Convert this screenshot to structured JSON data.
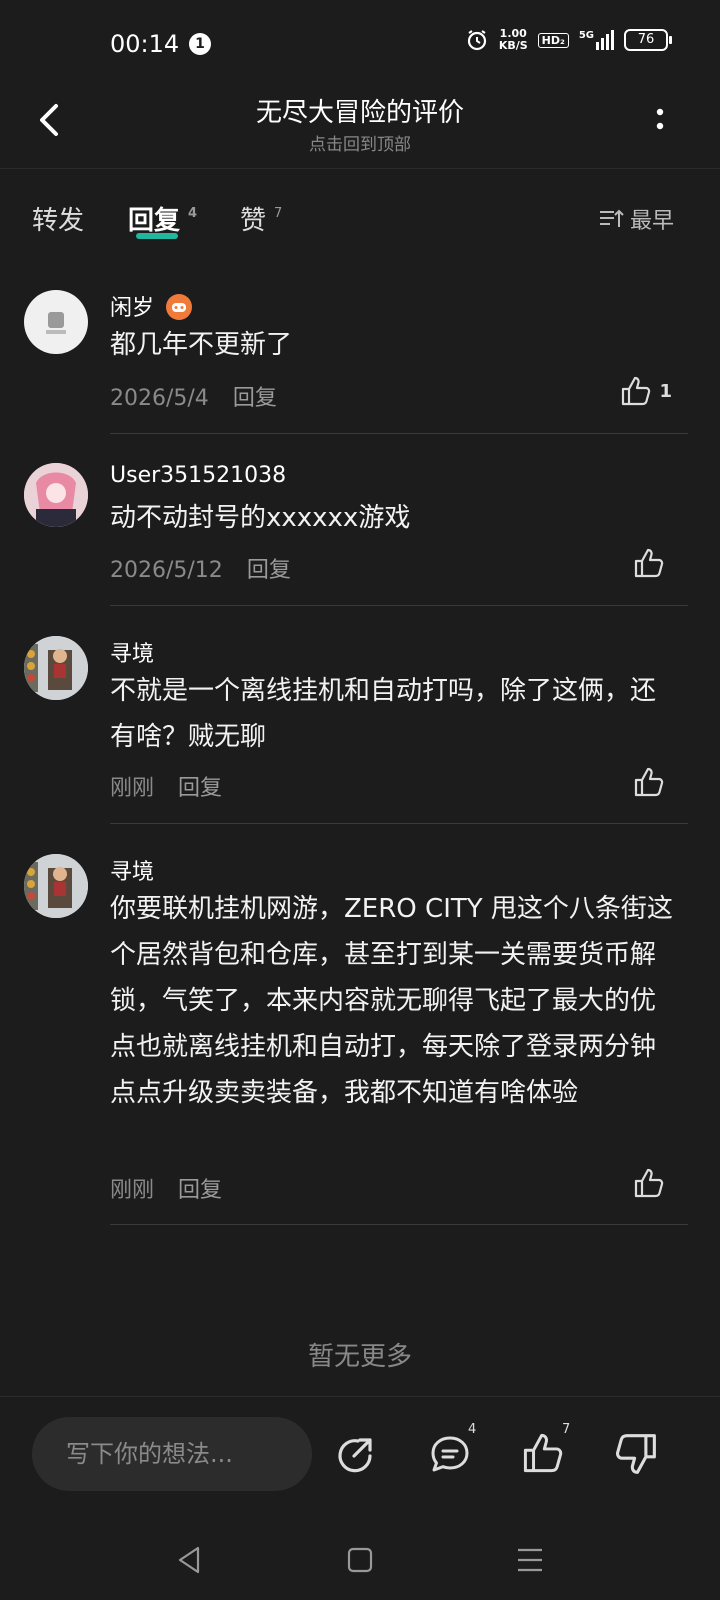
{
  "status": {
    "time": "00:14",
    "notif_count": "1",
    "speed_value": "1.00",
    "speed_unit": "KB/S",
    "hd": "HD₂",
    "network": "5G",
    "battery": "76"
  },
  "header": {
    "title": "无尽大冒险的评价",
    "subtitle": "点击回到顶部"
  },
  "tabs": [
    {
      "label": "转发",
      "count": ""
    },
    {
      "label": "回复",
      "count": "4"
    },
    {
      "label": "赞",
      "count": "7"
    }
  ],
  "sort_label": "最早",
  "comments": [
    {
      "name": "闲岁",
      "text": "都几年不更新了",
      "date": "2026/5/4",
      "reply": "回复",
      "likes": "1"
    },
    {
      "name": "User351521038",
      "text": "动不动封号的xxxxxx游戏",
      "date": "2026/5/12",
      "reply": "回复",
      "likes": ""
    },
    {
      "name": "寻境",
      "text": "不就是一个离线挂机和自动打吗，除了这俩，还有啥？贼无聊",
      "date": "刚刚",
      "reply": "回复",
      "likes": ""
    },
    {
      "name": "寻境",
      "text": "你要联机挂机网游，ZERO CITY 甩这个八条街这个居然背包和仓库，甚至打到某一关需要货币解锁，气笑了，本来内容就无聊得飞起了最大的优点也就离线挂机和自动打，每天除了登录两分钟点点升级卖卖装备，我都不知道有啥体验",
      "date": "刚刚",
      "reply": "回复",
      "likes": ""
    }
  ],
  "no_more": "暂无更多",
  "bottom": {
    "placeholder": "写下你的想法...",
    "comment_count": "4",
    "like_count": "7"
  }
}
